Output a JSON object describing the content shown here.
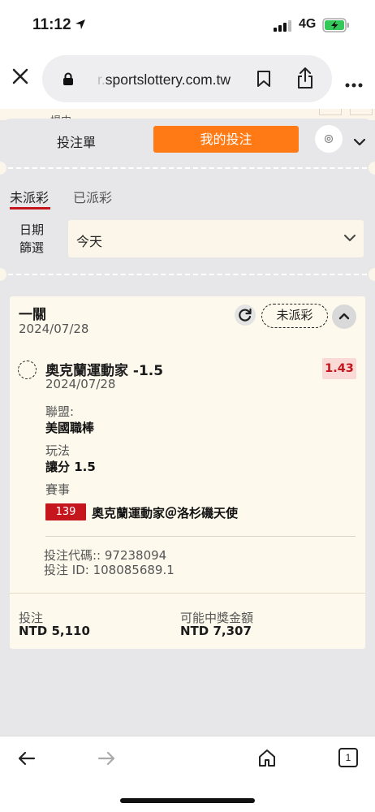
{
  "status_bar": {
    "time": "11:12",
    "network": "4G"
  },
  "browser": {
    "url_faded": "r.",
    "url": "sportslottery.com.tw"
  },
  "background": {
    "partial_text": "場中"
  },
  "panel": {
    "tab_betslip": "投注單",
    "tab_mybets": "我的投注",
    "status_tabs": {
      "active": "未派彩",
      "inactive": "已派彩"
    },
    "filter": {
      "label_line1": "日期",
      "label_line2": "篩選",
      "value": "今天"
    }
  },
  "bet": {
    "type": "一關",
    "date": "2024/07/28",
    "status": "未派彩",
    "selection": "奧克蘭運動家 -1.5",
    "selection_date": "2024/07/28",
    "odds": "1.43",
    "league_label": "聯盟:",
    "league": "美國職棒",
    "market_label": "玩法",
    "market": "讓分 1.5",
    "event_label": "賽事",
    "event_no": "139",
    "event": "奧克蘭運動家＠洛杉磯天使",
    "code_line": "投注代碼:: 97238094",
    "id_line": "投注 ID: 108085689.1",
    "stake_label": "投注",
    "stake": "NTD 5,110",
    "win_label": "可能中獎金額",
    "win": "NTD 7,307"
  },
  "toolbar": {
    "tab_count": "1"
  },
  "colors": {
    "accent": "#ff7a14",
    "red": "#c4161c",
    "card": "#fdf9ec"
  }
}
